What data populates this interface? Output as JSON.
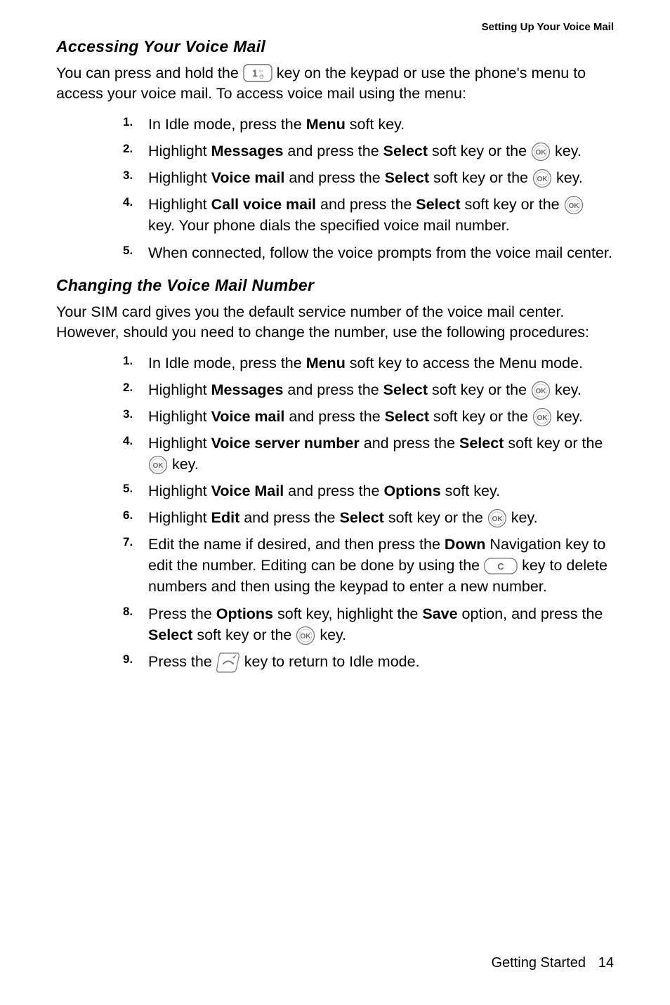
{
  "running_header": "Setting Up Your Voice Mail",
  "sections": {
    "access": {
      "title": "Accessing Your Voice Mail",
      "intro_parts": [
        "You can press and hold the ",
        " key on the keypad or use the phone's menu to access your voice mail. To access voice mail using the menu:"
      ],
      "steps": [
        {
          "frags": [
            {
              "t": "In Idle mode, press the "
            },
            {
              "t": "Menu",
              "b": true
            },
            {
              "t": " soft key."
            }
          ]
        },
        {
          "frags": [
            {
              "t": "Highlight "
            },
            {
              "t": "Messages",
              "b": true
            },
            {
              "t": " and press the "
            },
            {
              "t": "Select",
              "b": true
            },
            {
              "t": " soft key or the "
            },
            {
              "icon": "ok"
            },
            {
              "t": " key."
            }
          ]
        },
        {
          "frags": [
            {
              "t": "Highlight "
            },
            {
              "t": "Voice mail",
              "b": true
            },
            {
              "t": " and press the "
            },
            {
              "t": "Select",
              "b": true
            },
            {
              "t": " soft key or the "
            },
            {
              "icon": "ok"
            },
            {
              "t": " key."
            }
          ]
        },
        {
          "frags": [
            {
              "t": "Highlight "
            },
            {
              "t": "Call voice mail",
              "b": true
            },
            {
              "t": " and press the "
            },
            {
              "t": "Select",
              "b": true
            },
            {
              "t": " soft key or the "
            },
            {
              "icon": "ok"
            },
            {
              "t": " key. Your phone dials the specified voice mail number."
            }
          ]
        },
        {
          "frags": [
            {
              "t": "When connected, follow the voice prompts from the voice mail center."
            }
          ]
        }
      ]
    },
    "change": {
      "title": "Changing the Voice Mail Number",
      "intro": "Your SIM card gives you the default service number of the voice mail center. However, should you need to change the number, use the following procedures:",
      "steps": [
        {
          "frags": [
            {
              "t": "In Idle mode, press the "
            },
            {
              "t": "Menu",
              "b": true
            },
            {
              "t": " soft key to access the Menu mode."
            }
          ]
        },
        {
          "frags": [
            {
              "t": "Highlight "
            },
            {
              "t": "Messages",
              "b": true
            },
            {
              "t": " and press the "
            },
            {
              "t": "Select",
              "b": true
            },
            {
              "t": " soft key or the "
            },
            {
              "icon": "ok"
            },
            {
              "t": " key."
            }
          ]
        },
        {
          "frags": [
            {
              "t": "Highlight "
            },
            {
              "t": "Voice mail",
              "b": true
            },
            {
              "t": " and press the "
            },
            {
              "t": "Select",
              "b": true
            },
            {
              "t": " soft key or the "
            },
            {
              "icon": "ok"
            },
            {
              "t": " key."
            }
          ]
        },
        {
          "frags": [
            {
              "t": "Highlight "
            },
            {
              "t": "Voice server number",
              "b": true
            },
            {
              "t": " and press the "
            },
            {
              "t": "Select",
              "b": true
            },
            {
              "t": " soft key or the "
            },
            {
              "icon": "ok"
            },
            {
              "t": " key."
            }
          ]
        },
        {
          "frags": [
            {
              "t": "Highlight "
            },
            {
              "t": "Voice Mail",
              "b": true
            },
            {
              "t": " and press the "
            },
            {
              "t": "Options",
              "b": true
            },
            {
              "t": " soft key."
            }
          ]
        },
        {
          "frags": [
            {
              "t": "Highlight "
            },
            {
              "t": "Edit",
              "b": true
            },
            {
              "t": " and press the "
            },
            {
              "t": "Select",
              "b": true
            },
            {
              "t": " soft key or the "
            },
            {
              "icon": "ok"
            },
            {
              "t": " key."
            }
          ]
        },
        {
          "frags": [
            {
              "t": "Edit the name if desired, and then press the "
            },
            {
              "t": "Down",
              "b": true
            },
            {
              "t": " Navigation key to edit the number. Editing can be done by using the "
            },
            {
              "icon": "c"
            },
            {
              "t": " key to delete numbers and then using the keypad to enter a new number."
            }
          ]
        },
        {
          "frags": [
            {
              "t": "Press the "
            },
            {
              "t": "Options",
              "b": true
            },
            {
              "t": " soft key, highlight the "
            },
            {
              "t": "Save",
              "b": true
            },
            {
              "t": " option, and press the "
            },
            {
              "t": "Select",
              "b": true
            },
            {
              "t": " soft key or the "
            },
            {
              "icon": "ok"
            },
            {
              "t": " key."
            }
          ]
        },
        {
          "frags": [
            {
              "t": "Press the "
            },
            {
              "icon": "end"
            },
            {
              "t": " key to return to Idle mode."
            }
          ]
        }
      ]
    }
  },
  "footer": {
    "section": "Getting Started",
    "page": "14"
  }
}
